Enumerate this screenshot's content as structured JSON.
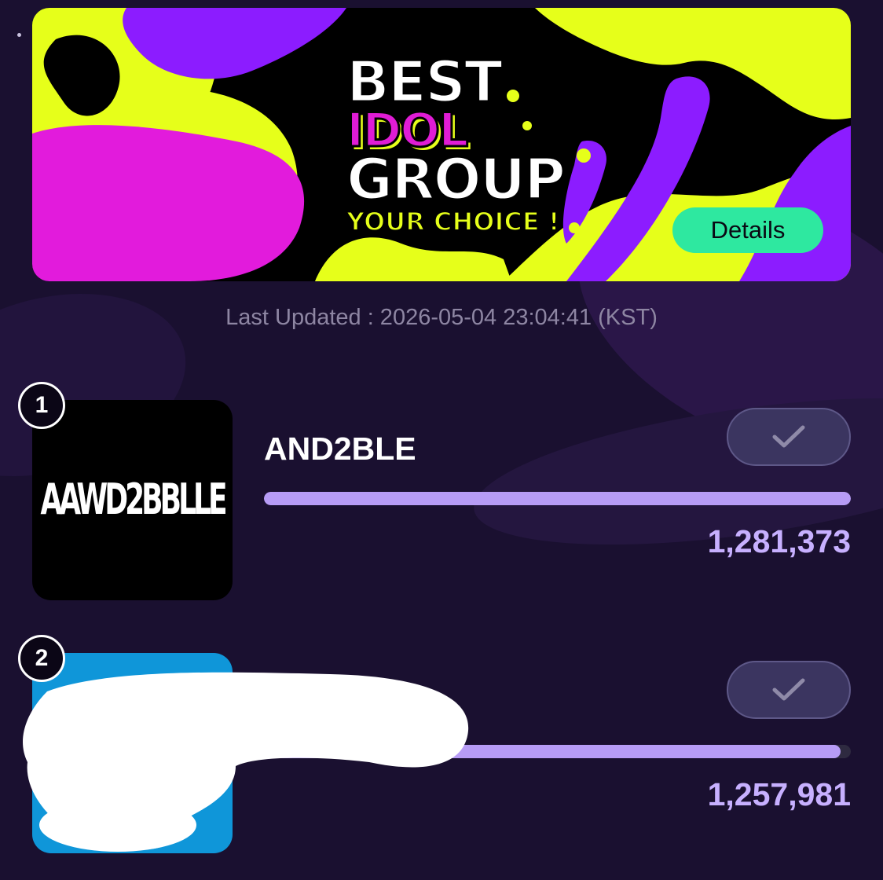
{
  "banner": {
    "title_line1": "BEST",
    "title_line2": "IDOL",
    "title_line3": "GROUP",
    "title_line4": "YOUR CHOICE !",
    "details_label": "Details",
    "colors": {
      "yellow": "#e6ff1a",
      "magenta": "#e21bdc",
      "purple": "#8c1cff",
      "details_bg": "#2ee8a0"
    }
  },
  "last_updated": "Last Updated : 2026-05-04 23:04:41 (KST)",
  "rankings": [
    {
      "rank": "1",
      "name": "AND2BLE",
      "logo_text": "AAWD2BBLLE",
      "votes": "1,281,373",
      "progress": 1.0,
      "vote_icon": "check-icon"
    },
    {
      "rank": "2",
      "votes": "1,257,981",
      "progress": 0.982,
      "vote_icon": "check-icon",
      "redacted": true
    }
  ],
  "colors": {
    "background": "#1a1030",
    "progress_fill": "#b79cf6",
    "vote_count": "#c7b0ff"
  }
}
